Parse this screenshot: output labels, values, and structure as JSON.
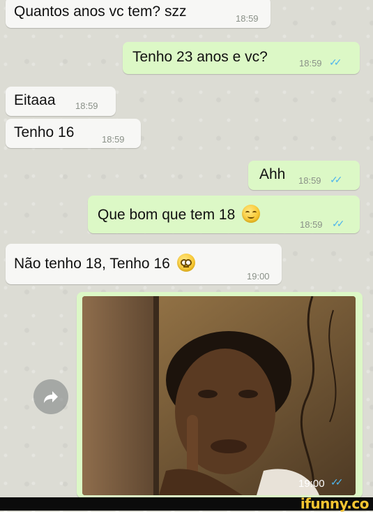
{
  "messages": [
    {
      "direction": "in",
      "text": "Quantos anos vc tem? szz",
      "time": "18:59"
    },
    {
      "direction": "out",
      "text": "Tenho 23 anos e vc?",
      "time": "18:59",
      "ticks": "✓✓"
    },
    {
      "direction": "in",
      "text": "Eitaaa",
      "time": "18:59"
    },
    {
      "direction": "in",
      "text": "Tenho 16",
      "time": "18:59"
    },
    {
      "direction": "out",
      "text": "Ahh",
      "time": "18:59",
      "ticks": "✓✓"
    },
    {
      "direction": "out",
      "text": "Que bom que tem 18",
      "emoji": "smirking-face",
      "time": "18:59",
      "ticks": "✓✓"
    },
    {
      "direction": "in",
      "text": "Não tenho 18, Tenho 16",
      "emoji": "flushed-face",
      "time": "19:00"
    }
  ],
  "photo_message": {
    "direction": "out",
    "time": "19:00",
    "ticks": "✓✓"
  },
  "forward_icon": "forward-arrow-icon",
  "watermark": "ifunny.co",
  "colors": {
    "incoming": "#f7f7f5",
    "outgoing": "#dcf8c6",
    "read_ticks": "#4fb6ec",
    "watermark": "#f6c531"
  }
}
